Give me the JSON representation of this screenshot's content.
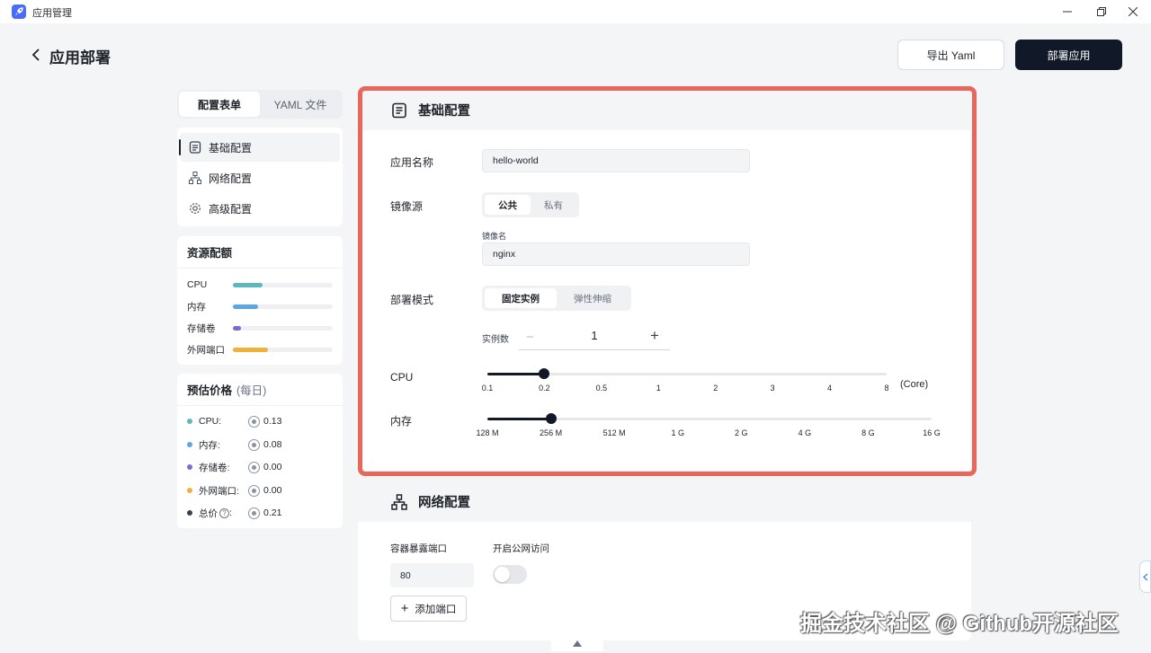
{
  "window": {
    "title": "应用管理",
    "minimize_icon": "minimize-icon",
    "restore_icon": "restore-icon",
    "close_icon": "close-icon"
  },
  "header": {
    "title": "应用部署",
    "export_label": "导出 Yaml",
    "deploy_label": "部署应用"
  },
  "left_tabs": [
    {
      "label": "配置表单",
      "active": true
    },
    {
      "label": "YAML 文件",
      "active": false
    }
  ],
  "nav": [
    {
      "label": "基础配置",
      "icon": "document-icon",
      "active": true
    },
    {
      "label": "网络配置",
      "icon": "network-icon",
      "active": false
    },
    {
      "label": "高级配置",
      "icon": "gear-icon",
      "active": false
    }
  ],
  "resources": {
    "title": "资源配额",
    "items": [
      {
        "label": "CPU",
        "fraction": 0.3,
        "color": "#5cb8bd"
      },
      {
        "label": "内存",
        "fraction": 0.25,
        "color": "#5aa7e6"
      },
      {
        "label": "存储卷",
        "fraction": 0.08,
        "color": "#7b6cd0"
      },
      {
        "label": "外网端口",
        "fraction": 0.35,
        "color": "#f0b03a"
      }
    ]
  },
  "price": {
    "title": "预估价格",
    "subtitle": "(每日)",
    "items": [
      {
        "label": "CPU:",
        "value": "0.13",
        "color": "#5cb8bd"
      },
      {
        "label": "内存:",
        "value": "0.08",
        "color": "#5aa7e6"
      },
      {
        "label": "存储卷:",
        "value": "0.00",
        "color": "#7b6cd0"
      },
      {
        "label": "外网端口:",
        "value": "0.00",
        "color": "#f0b03a"
      },
      {
        "label": "总价",
        "value": "0.21",
        "color": "#374151"
      }
    ]
  },
  "basic": {
    "title": "基础配置",
    "app_name_label": "应用名称",
    "app_name_value": "hello-world",
    "image_label": "镜像源",
    "image_options": [
      {
        "label": "公共",
        "on": true
      },
      {
        "label": "私有",
        "on": false
      }
    ],
    "image_name_label": "镜像名",
    "image_name_value": "nginx",
    "mode_label": "部署模式",
    "mode_options": [
      {
        "label": "固定实例",
        "on": true
      },
      {
        "label": "弹性伸缩",
        "on": false
      }
    ],
    "instances_label": "实例数",
    "instances_value": "1",
    "minus": "−",
    "plus": "+",
    "cpu_label": "CPU",
    "cpu_ticks": [
      "0.1",
      "0.2",
      "0.5",
      "1",
      "2",
      "3",
      "4",
      "8"
    ],
    "cpu_selected": "0.2",
    "cpu_unit": "(Core)",
    "mem_label": "内存",
    "mem_ticks": [
      "128 M",
      "256 M",
      "512 M",
      "1 G",
      "2 G",
      "4 G",
      "8 G",
      "16 G"
    ],
    "mem_selected": "256 M"
  },
  "network": {
    "title": "网络配置",
    "port_label": "容器暴露端口",
    "public_label": "开启公网访问",
    "port_value": "80",
    "public_enabled": false,
    "add_label": "添加端口",
    "add_icon": "+"
  },
  "watermark": "掘金技术社区 @ Github开源社区"
}
